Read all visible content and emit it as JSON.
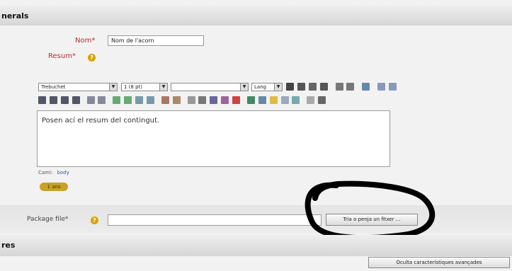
{
  "section": {
    "title": "nerals",
    "bottom_title": "res"
  },
  "form": {
    "name_label": "Nom*",
    "name_value": "Nom de l'acorn",
    "summary_label": "Resum*",
    "package_label": "Package file*"
  },
  "editor": {
    "font_family": "Trebuchet",
    "font_size": "1 (8 pt)",
    "format": "",
    "language": "Lang",
    "text_area": "Posen ací el resum del contingut.",
    "path_label": "Camí:",
    "path_value": "body",
    "toolbar_row1": [
      "bold-icon",
      "italic-icon",
      "underline-icon",
      "strikethrough-icon",
      "subscript-icon",
      "superscript-icon",
      "clean-icon",
      "undo-icon",
      "redo-icon"
    ],
    "toolbar_row2": [
      "align-left-icon",
      "align-center-icon",
      "align-right-icon",
      "justify-icon",
      "ltr-icon",
      "rtl-icon",
      "ordered-list-icon",
      "unordered-list-icon",
      "outdent-icon",
      "indent-icon",
      "text-color-icon",
      "bg-color-icon",
      "rule-icon",
      "anchor-icon",
      "link-icon",
      "unlink-icon",
      "nolink-icon",
      "image-icon",
      "table-icon",
      "emoticon-icon",
      "special-char-icon",
      "search-replace-icon",
      "html-icon",
      "fullscreen-icon"
    ]
  },
  "badge": "1 ans",
  "buttons": {
    "choose_file": "Tria o penja un fitxer ...",
    "advanced": "Oculta característiques avançades"
  },
  "colors": {
    "annotation": "#000000",
    "accent": "#d9a400",
    "label": "#b03030"
  }
}
